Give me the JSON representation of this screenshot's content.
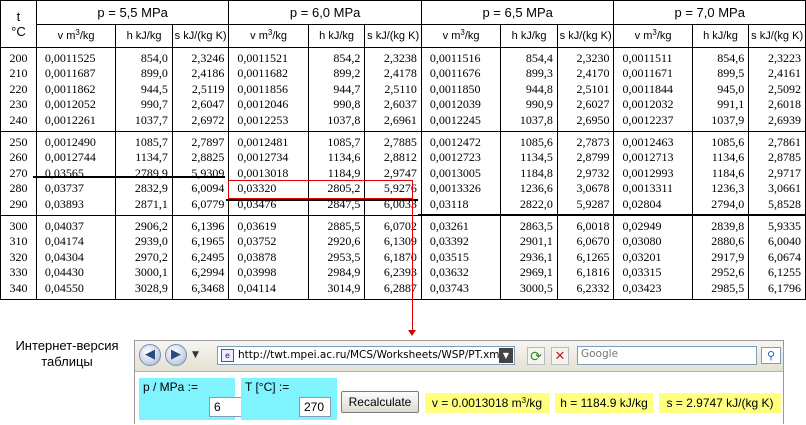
{
  "table": {
    "t_header": "t",
    "t_unit": "°C",
    "pressures": [
      "p = 5,5 MPa",
      "p = 6,0 MPa",
      "p = 6,5 MPa",
      "p = 7,0 MPa"
    ],
    "col_v": "v m",
    "col_v_sup": "3",
    "col_v_tail": "/kg",
    "col_h": "h kJ/kg",
    "col_s": "s kJ/(kg K)",
    "blocks": [
      {
        "t": [
          "200",
          "210",
          "220",
          "230",
          "240"
        ],
        "v": [
          [
            "0,0011525",
            "0,0011687",
            "0,0011862",
            "0,0012052",
            "0,0012261"
          ],
          [
            "0,0011521",
            "0,0011682",
            "0,0011856",
            "0,0012046",
            "0,0012253"
          ],
          [
            "0,0011516",
            "0,0011676",
            "0,0011850",
            "0,0012039",
            "0,0012245"
          ],
          [
            "0,0011511",
            "0,0011671",
            "0,0011844",
            "0,0012032",
            "0,0012237"
          ]
        ],
        "h": [
          [
            "854,0",
            "899,0",
            "944,5",
            "990,7",
            "1037,7"
          ],
          [
            "854,2",
            "899,2",
            "944,7",
            "990,8",
            "1037,8"
          ],
          [
            "854,4",
            "899,3",
            "944,8",
            "990,9",
            "1037,8"
          ],
          [
            "854,6",
            "899,5",
            "945,0",
            "991,1",
            "1037,9"
          ]
        ],
        "s": [
          [
            "2,3246",
            "2,4186",
            "2,5119",
            "2,6047",
            "2,6972"
          ],
          [
            "2,3238",
            "2,4178",
            "2,5110",
            "2,6037",
            "2,6961"
          ],
          [
            "2,3230",
            "2,4170",
            "2,5101",
            "2,6027",
            "2,6950"
          ],
          [
            "2,3223",
            "2,4161",
            "2,5092",
            "2,6018",
            "2,6939"
          ]
        ]
      },
      {
        "t": [
          "250",
          "260",
          "270",
          "280",
          "290"
        ],
        "v": [
          [
            "0,0012490",
            "0,0012744",
            "0,03565",
            "0,03737",
            "0,03893"
          ],
          [
            "0,0012481",
            "0,0012734",
            "0,0013018",
            "0,03320",
            "0,03476"
          ],
          [
            "0,0012472",
            "0,0012723",
            "0,0013005",
            "0,0013326",
            "0,03118"
          ],
          [
            "0,0012463",
            "0,0012713",
            "0,0012993",
            "0,0013311",
            "0,02804"
          ]
        ],
        "h": [
          [
            "1085,7",
            "1134,7",
            "2789,9",
            "2832,9",
            "2871,1"
          ],
          [
            "1085,7",
            "1134,6",
            "1184,9",
            "2805,2",
            "2847,5"
          ],
          [
            "1085,6",
            "1134,5",
            "1184,8",
            "1236,6",
            "2822,0"
          ],
          [
            "1085,6",
            "1134,6",
            "1184,6",
            "1236,3",
            "2794,0"
          ]
        ],
        "s": [
          [
            "2,7897",
            "2,8825",
            "5,9309",
            "6,0094",
            "6,0779"
          ],
          [
            "2,7885",
            "2,8812",
            "2,9747",
            "5,9276",
            "6,0033"
          ],
          [
            "2,7873",
            "2,8799",
            "2,9732",
            "3,0678",
            "5,9287"
          ],
          [
            "2,7861",
            "2,8785",
            "2,9717",
            "3,0661",
            "5,8528"
          ]
        ]
      },
      {
        "t": [
          "300",
          "310",
          "320",
          "330",
          "340"
        ],
        "v": [
          [
            "0,04037",
            "0,04174",
            "0,04304",
            "0,04430",
            "0,04550"
          ],
          [
            "0,03619",
            "0,03752",
            "0,03878",
            "0,03998",
            "0,04114"
          ],
          [
            "0,03261",
            "0,03392",
            "0,03515",
            "0,03632",
            "0,03743"
          ],
          [
            "0,02949",
            "0,03080",
            "0,03201",
            "0,03315",
            "0,03423"
          ]
        ],
        "h": [
          [
            "2906,2",
            "2939,0",
            "2970,2",
            "3000,1",
            "3028,9"
          ],
          [
            "2885,5",
            "2920,6",
            "2953,5",
            "2984,9",
            "3014,9"
          ],
          [
            "2863,5",
            "2901,1",
            "2936,1",
            "2969,1",
            "3000,5"
          ],
          [
            "2839,8",
            "2880,6",
            "2917,9",
            "2952,6",
            "2985,5"
          ]
        ],
        "s": [
          [
            "6,1396",
            "6,1965",
            "6,2495",
            "6,2994",
            "6,3468"
          ],
          [
            "6,0702",
            "6,1309",
            "6,1870",
            "6,2393",
            "6,2887"
          ],
          [
            "6,0018",
            "6,0670",
            "6,1265",
            "6,1816",
            "6,2332"
          ],
          [
            "5,9335",
            "6,0040",
            "6,0674",
            "6,1255",
            "6,1796"
          ]
        ]
      }
    ]
  },
  "caption": {
    "line1": "Интернет-версия",
    "line2": "таблицы"
  },
  "browser": {
    "url": "http://twt.mpei.ac.ru/MCS/Worksheets/WSP/PT.xmcd",
    "search_placeholder": "Google",
    "back_glyph": "◀",
    "forward_glyph": "▶",
    "dropdown_glyph": "▼",
    "refresh_glyph": "⟳",
    "stop_glyph": "✕",
    "search_engine_glyph": "⚲"
  },
  "form": {
    "p_label": "p / MPa :=",
    "p_value": "6",
    "t_label": "T [°C] :=",
    "t_value": "270",
    "recalc_label": "Recalculate",
    "v_result_prefix": "v = 0.0013018 m",
    "v_result_sup": "3",
    "v_result_tail": "/kg",
    "h_result": "h = 1184.9 kJ/kg",
    "s_result": "s = 2.9747 kJ/(kg K)"
  },
  "colors": {
    "input_bg": "#7ff4ff",
    "result_bg": "#ffff80",
    "highlight": "#dd0000"
  }
}
